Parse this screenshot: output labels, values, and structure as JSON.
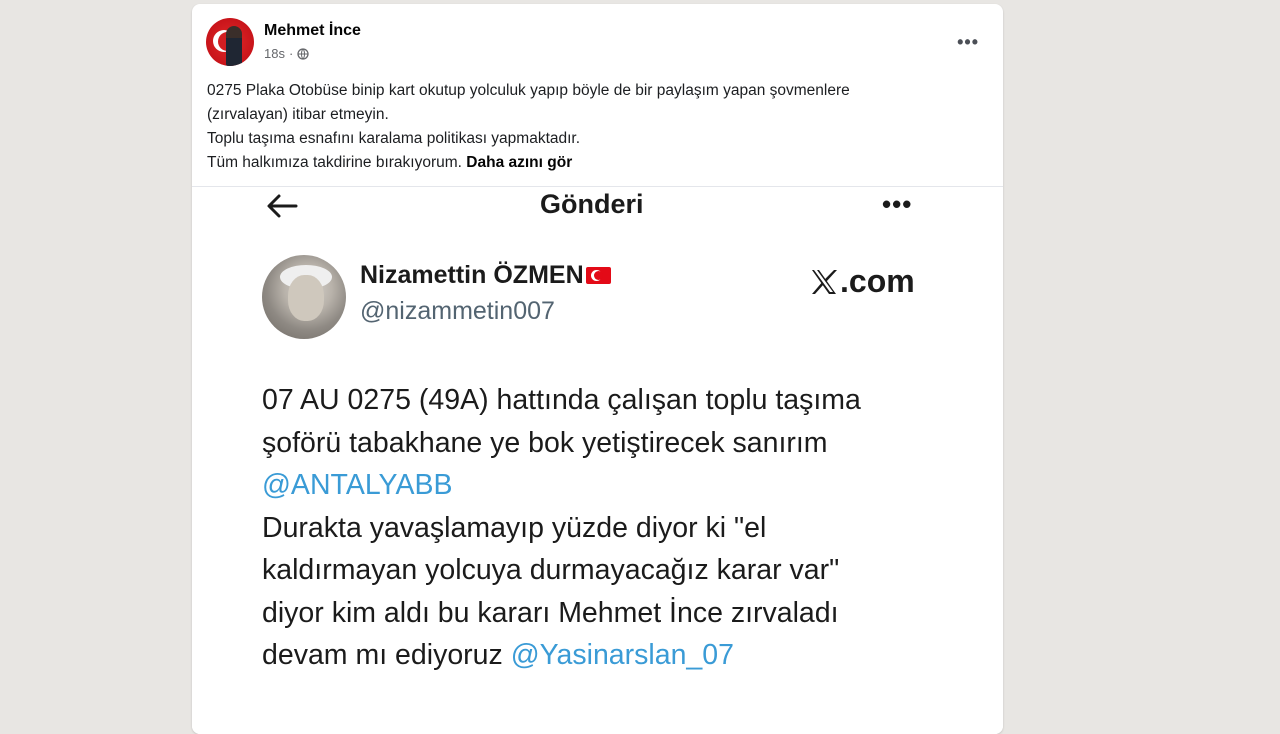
{
  "post": {
    "author": "Mehmet İnce",
    "time": "18s",
    "more_label": "•••",
    "text_lines": [
      "0275 Plaka Otobüse binip kart okutup yolculuk yapıp böyle de bir paylaşım yapan şovmenlere",
      "(zırvalayan) itibar etmeyin.",
      "Toplu taşıma esnafını karalama politikası yapmaktadır.",
      "Tüm halkımıza takdirine bırakıyorum."
    ],
    "see_more_label": "Daha azını gör"
  },
  "screenshot": {
    "title": "Gönderi",
    "more_label": "•••",
    "tweet": {
      "name": "Nizamettin ÖZMEN",
      "handle": "@nizammetin007",
      "watermark": ".com",
      "body_lines": [
        {
          "text": "07 AU 0275 (49A) hattında çalışan toplu taşıma",
          "mention": ""
        },
        {
          "text": "şoförü tabakhane ye bok yetiştirecek sanırım",
          "mention": ""
        },
        {
          "text": "",
          "mention": "@ANTALYABB"
        },
        {
          "text": "Durakta yavaşlamayıp yüzde diyor ki \"el",
          "mention": ""
        },
        {
          "text": "kaldırmayan yolcuya durmayacağız karar var\"",
          "mention": ""
        },
        {
          "text": "diyor kim aldı bu kararı Mehmet İnce zırvaladı",
          "mention": ""
        },
        {
          "text": "devam mı ediyoruz ",
          "mention": "@Yasinarslan_07"
        }
      ]
    }
  },
  "colors": {
    "background": "#e8e6e3",
    "card": "#ffffff",
    "mention": "#3a9bd6",
    "secondary_text": "#65676b",
    "flag_red": "#e30a17"
  },
  "icons": {
    "globe": "globe-icon",
    "back": "back-arrow-icon",
    "flag": "turkey-flag-icon",
    "x_logo": "x-logo-icon"
  }
}
